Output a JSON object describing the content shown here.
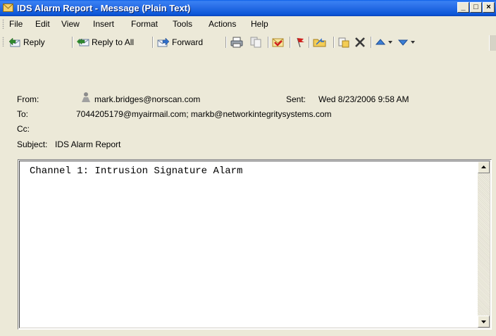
{
  "window": {
    "title": "IDS Alarm Report - Message (Plain Text)"
  },
  "window_controls": {
    "minimize": "_",
    "maximize": "□",
    "close": "×"
  },
  "menu": [
    {
      "label": "File",
      "access_key": "F"
    },
    {
      "label": "Edit",
      "access_key": "E"
    },
    {
      "label": "View",
      "access_key": "V"
    },
    {
      "label": "Insert",
      "access_key": "I"
    },
    {
      "label": "Format",
      "access_key": "o"
    },
    {
      "label": "Tools",
      "access_key": "T"
    },
    {
      "label": "Actions",
      "access_key": "A"
    },
    {
      "label": "Help",
      "access_key": "H"
    }
  ],
  "toolbar": {
    "reply_label": "Reply",
    "reply_all_label": "Reply to All",
    "forward_label": "Forward"
  },
  "header": {
    "from_label": "From:",
    "from_value": "mark.bridges@norscan.com",
    "sent_label": "Sent:",
    "sent_value": "Wed 8/23/2006 9:58 AM",
    "to_label": "To:",
    "to_value": "7044205179@myairmail.com; markb@networkintegritysystems.com",
    "cc_label": "Cc:",
    "cc_value": "",
    "subject_label": "Subject:",
    "subject_value": "IDS Alarm Report"
  },
  "body": {
    "text": "Channel 1: Intrusion Signature Alarm"
  },
  "colors": {
    "titlebar": "#0c57d8",
    "chrome": "#ece9d8"
  }
}
